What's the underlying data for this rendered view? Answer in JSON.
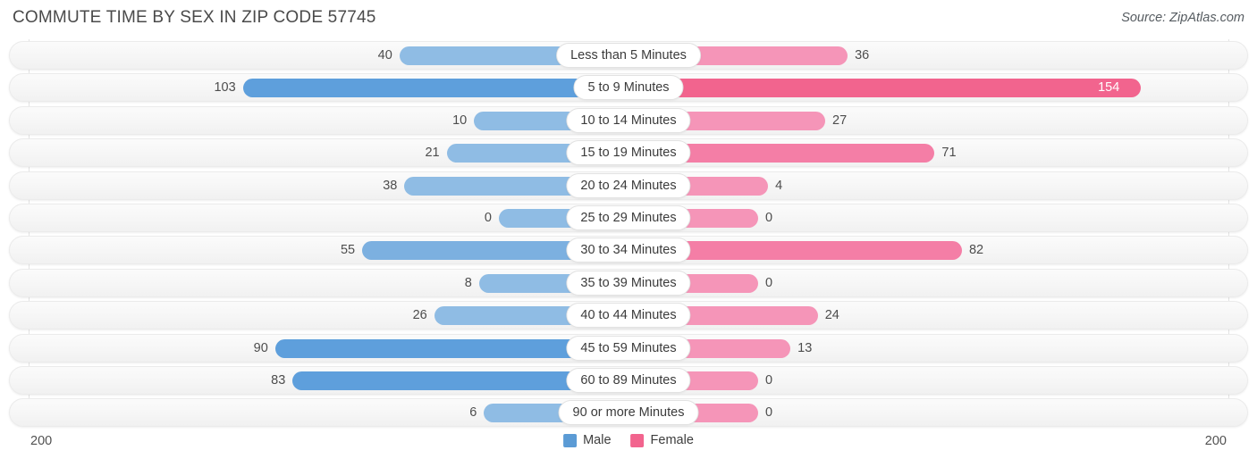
{
  "header": {
    "title": "COMMUTE TIME BY SEX IN ZIP CODE 57745",
    "source": "Source: ZipAtlas.com"
  },
  "axis": {
    "left_label": "200",
    "right_label": "200",
    "max": 200
  },
  "legend": {
    "items": [
      {
        "label": "Male",
        "color": "#5B9BD5"
      },
      {
        "label": "Female",
        "color": "#F2648E"
      }
    ]
  },
  "colors": {
    "male_light": "#8FBCE4",
    "male_mid": "#7CB0E0",
    "male_strong": "#5E9FDC",
    "female_light": "#F595B8",
    "female_mid": "#F47EA6",
    "female_strong": "#F2648E",
    "track": "#f6f6f6",
    "text": "#4d4d4d"
  },
  "chart_data": {
    "type": "bar",
    "orientation": "diverging-horizontal",
    "title": "COMMUTE TIME BY SEX IN ZIP CODE 57745",
    "xlabel": "",
    "ylabel": "",
    "xlim": [
      200,
      200
    ],
    "grid": false,
    "legend_position": "bottom-center",
    "categories": [
      "Less than 5 Minutes",
      "5 to 9 Minutes",
      "10 to 14 Minutes",
      "15 to 19 Minutes",
      "20 to 24 Minutes",
      "25 to 29 Minutes",
      "30 to 34 Minutes",
      "35 to 39 Minutes",
      "40 to 44 Minutes",
      "45 to 59 Minutes",
      "60 to 89 Minutes",
      "90 or more Minutes"
    ],
    "series": [
      {
        "name": "Male",
        "values": [
          40,
          103,
          10,
          21,
          38,
          0,
          55,
          8,
          26,
          90,
          83,
          6
        ]
      },
      {
        "name": "Female",
        "values": [
          36,
          154,
          27,
          71,
          4,
          0,
          82,
          0,
          24,
          13,
          0,
          0
        ]
      }
    ]
  },
  "rows": [
    {
      "label": "Less than 5 Minutes",
      "male": 40,
      "female": 36,
      "male_text": "40",
      "female_text": "36",
      "female_inside": false
    },
    {
      "label": "5 to 9 Minutes",
      "male": 103,
      "female": 154,
      "male_text": "103",
      "female_text": "154",
      "female_inside": true
    },
    {
      "label": "10 to 14 Minutes",
      "male": 10,
      "female": 27,
      "male_text": "10",
      "female_text": "27",
      "female_inside": false
    },
    {
      "label": "15 to 19 Minutes",
      "male": 21,
      "female": 71,
      "male_text": "21",
      "female_text": "71",
      "female_inside": false
    },
    {
      "label": "20 to 24 Minutes",
      "male": 38,
      "female": 4,
      "male_text": "38",
      "female_text": "4",
      "female_inside": false
    },
    {
      "label": "25 to 29 Minutes",
      "male": 0,
      "female": 0,
      "male_text": "0",
      "female_text": "0",
      "female_inside": false
    },
    {
      "label": "30 to 34 Minutes",
      "male": 55,
      "female": 82,
      "male_text": "55",
      "female_text": "82",
      "female_inside": false
    },
    {
      "label": "35 to 39 Minutes",
      "male": 8,
      "female": 0,
      "male_text": "8",
      "female_text": "0",
      "female_inside": false
    },
    {
      "label": "40 to 44 Minutes",
      "male": 26,
      "female": 24,
      "male_text": "26",
      "female_text": "24",
      "female_inside": false
    },
    {
      "label": "45 to 59 Minutes",
      "male": 90,
      "female": 13,
      "male_text": "90",
      "female_text": "13",
      "female_inside": false
    },
    {
      "label": "60 to 89 Minutes",
      "male": 83,
      "female": 0,
      "male_text": "83",
      "female_text": "0",
      "female_inside": false
    },
    {
      "label": "90 or more Minutes",
      "male": 6,
      "female": 0,
      "male_text": "6",
      "female_text": "0",
      "female_inside": false
    }
  ]
}
